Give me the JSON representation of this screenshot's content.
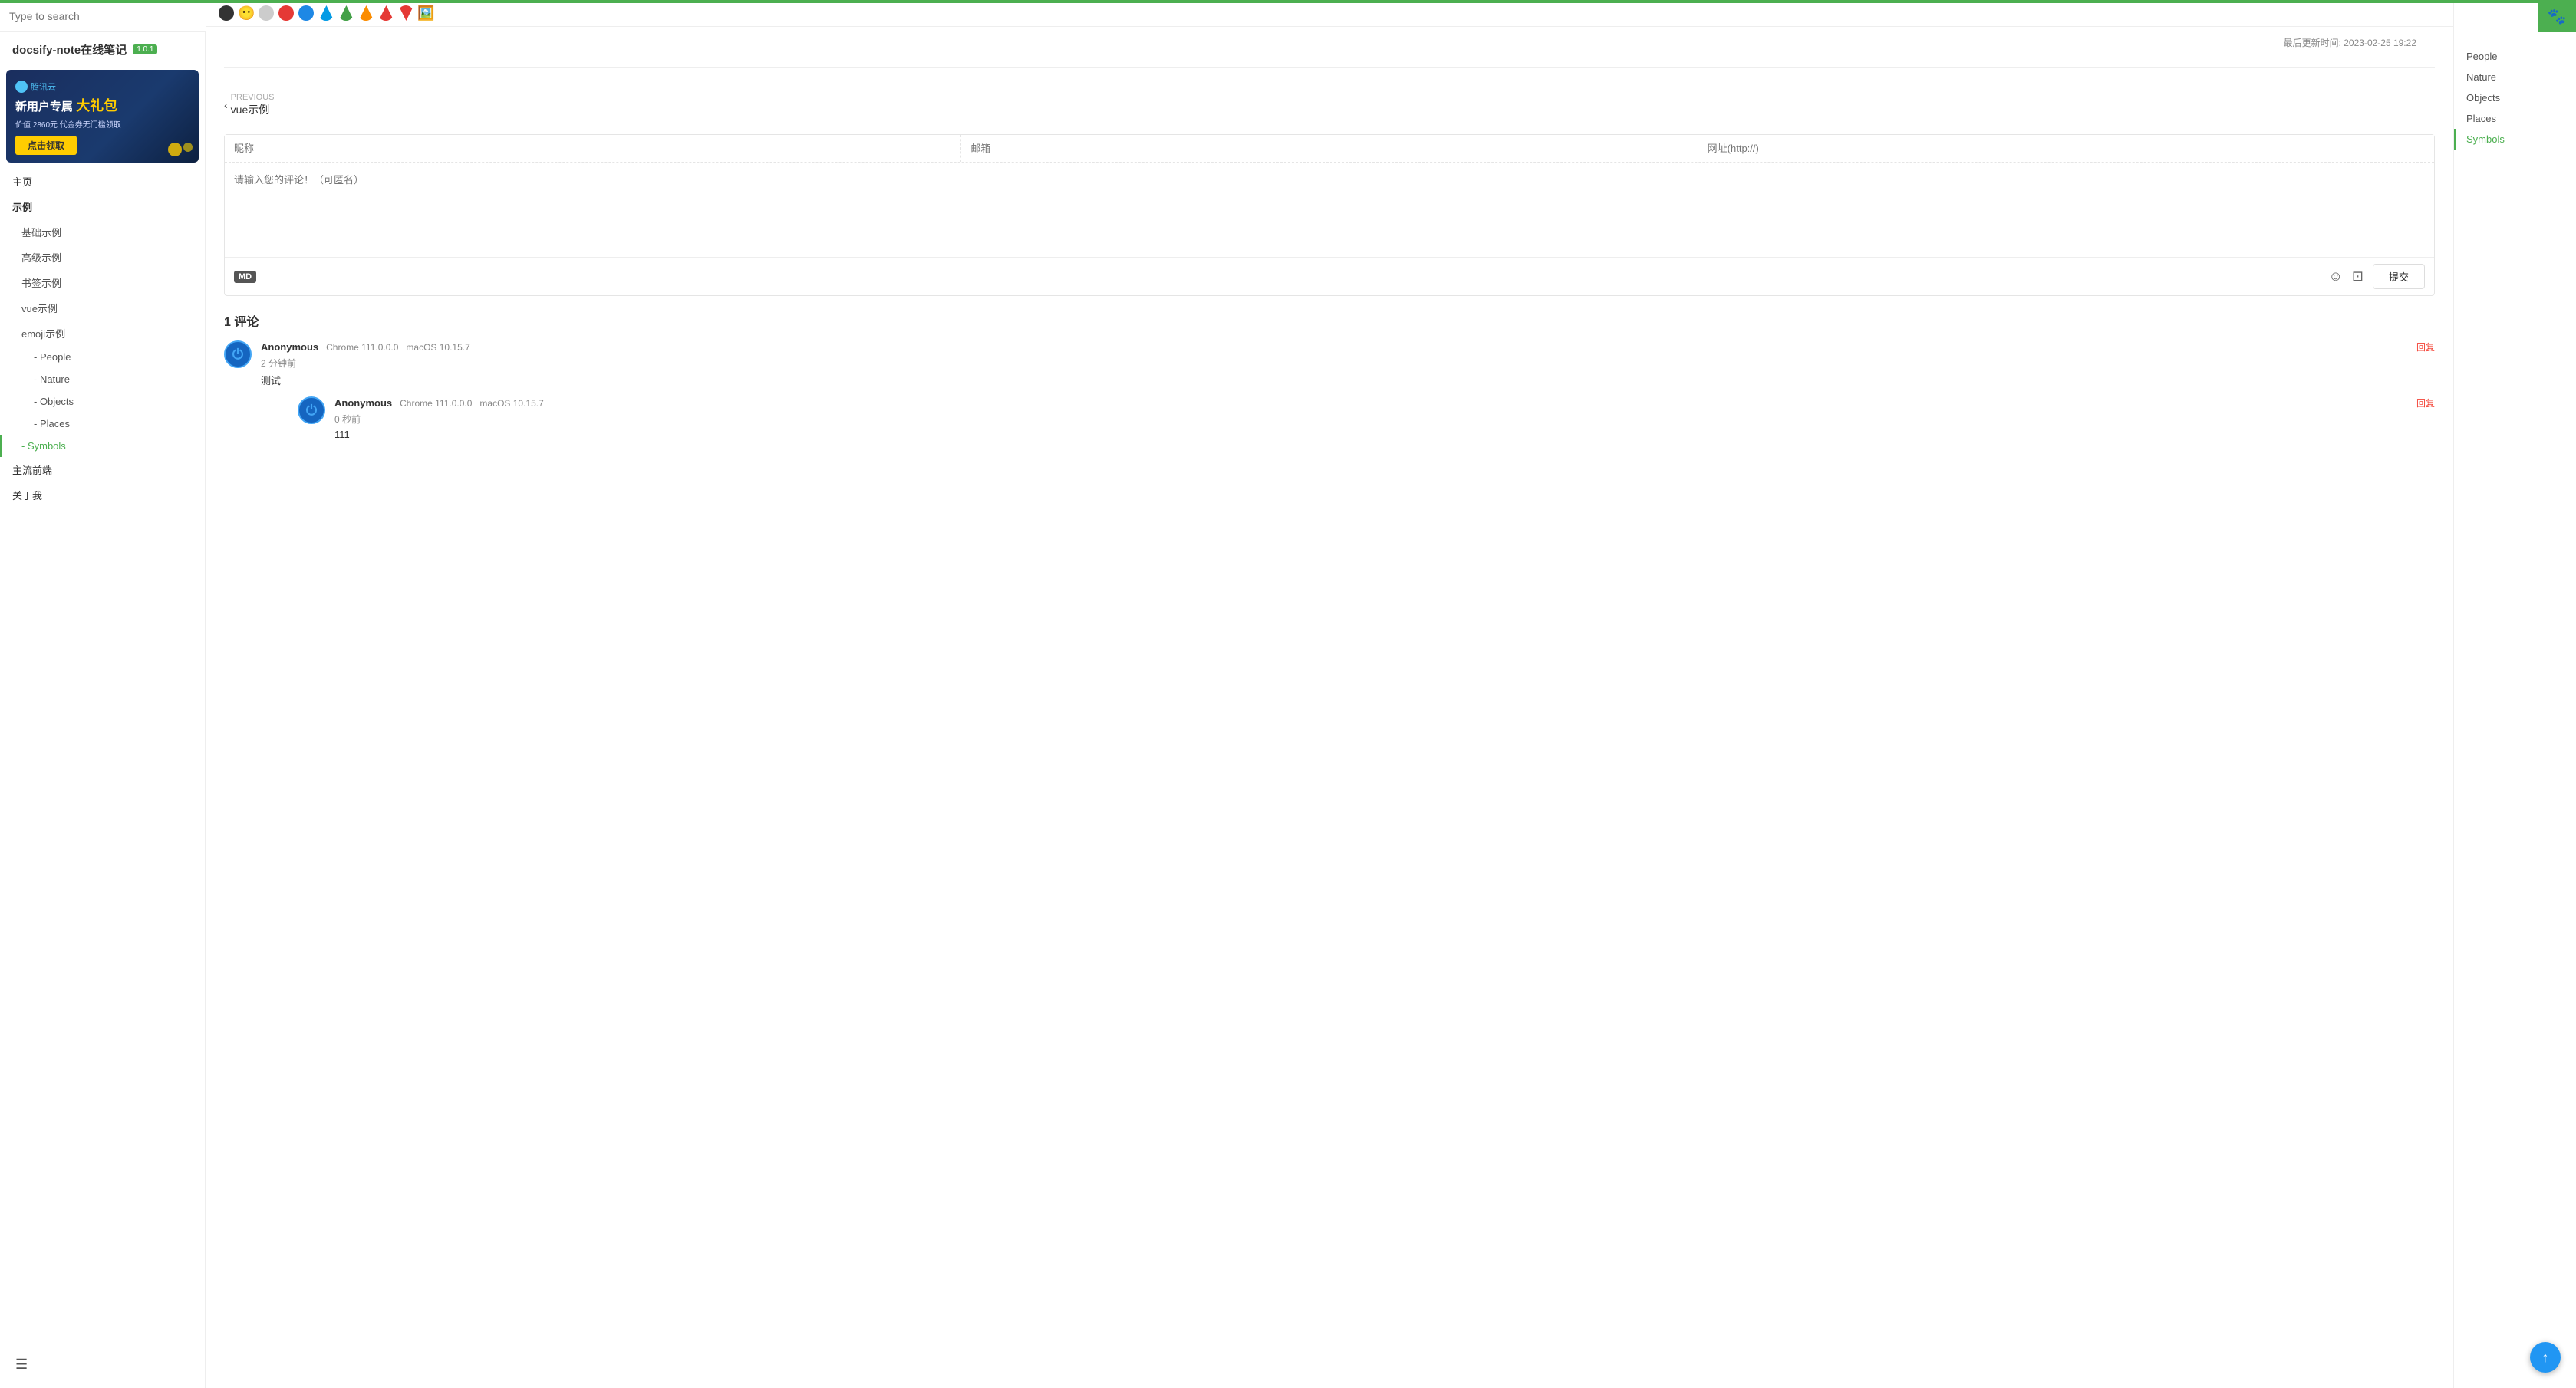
{
  "topBar": {
    "greenBarHeight": "4px",
    "searchPlaceholder": "Type to search"
  },
  "sidebar": {
    "title": "docsify-note在线笔记",
    "versionBadge": "1.0.1",
    "ad": {
      "logoText": "腾讯云",
      "headline1": "新用户专属",
      "headline2": "大礼包",
      "subtext": "价值 2860元 代金券无门槛领取",
      "btnLabel": "点击领取"
    },
    "navItems": [
      {
        "label": "主页",
        "level": 0,
        "active": false
      },
      {
        "label": "示例",
        "level": 0,
        "active": false
      },
      {
        "label": "基础示例",
        "level": 1,
        "active": false
      },
      {
        "label": "高级示例",
        "level": 1,
        "active": false
      },
      {
        "label": "书签示例",
        "level": 1,
        "active": false
      },
      {
        "label": "vue示例",
        "level": 1,
        "active": false
      },
      {
        "label": "emoji示例",
        "level": 1,
        "active": false
      },
      {
        "label": "- People",
        "level": 2,
        "active": false
      },
      {
        "label": "- Nature",
        "level": 2,
        "active": false
      },
      {
        "label": "- Objects",
        "level": 2,
        "active": false
      },
      {
        "label": "- Places",
        "level": 2,
        "active": false
      },
      {
        "label": "- Symbols",
        "level": 2,
        "active": true
      }
    ],
    "bottomItems": [
      {
        "label": "主流前端"
      },
      {
        "label": "关于我"
      }
    ]
  },
  "toc": {
    "items": [
      {
        "label": "People",
        "active": false
      },
      {
        "label": "Nature",
        "active": false
      },
      {
        "label": "Objects",
        "active": false
      },
      {
        "label": "Places",
        "active": false
      },
      {
        "label": "Symbols",
        "active": true
      }
    ]
  },
  "content": {
    "lastUpdated": "最后更新时间: 2023-02-25 19:22",
    "prevNav": {
      "prevLabel": "PREVIOUS",
      "prevTitle": "vue示例"
    },
    "commentForm": {
      "nicknamePlaceholder": "昵称",
      "emailPlaceholder": "邮箱",
      "websitePlaceholder": "网址(http://)",
      "contentPlaceholder": "请输入您的评论！（可匿名）",
      "submitLabel": "提交",
      "mdBadge": "MD"
    },
    "commentsHeader": "1 评论",
    "comments": [
      {
        "id": 1,
        "author": "Anonymous",
        "browser": "Chrome 111.0.0.0",
        "os": "macOS 10.15.7",
        "time": "2 分钟前",
        "text": "测试",
        "replyLabel": "回复",
        "nested": [
          {
            "author": "Anonymous",
            "browser": "Chrome 111.0.0.0",
            "os": "macOS 10.15.7",
            "time": "0 秒前",
            "text": "111",
            "replyLabel": "回复"
          }
        ]
      }
    ]
  },
  "emojis": {
    "topRowColors": [
      "#333",
      "#555",
      "#aaa",
      "#e53935",
      "#1e88e5",
      "#039be5",
      "#43a047",
      "#fb8c00",
      "#8e24aa",
      "#e53935",
      "#000"
    ],
    "photoEmoji": true
  },
  "fab": {
    "icon": "↑"
  },
  "menuBtn": {
    "icon": "☰"
  },
  "topRightIcon": {
    "icon": "🐾"
  }
}
